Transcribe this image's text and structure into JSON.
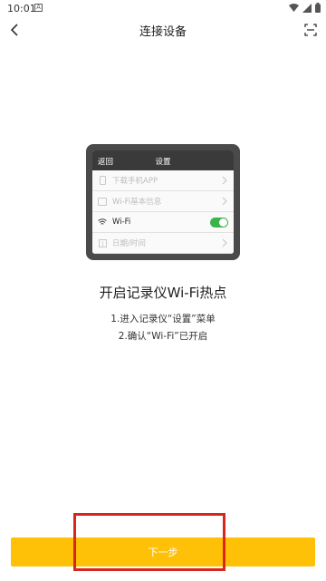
{
  "status_bar": {
    "time": "10:01",
    "notif": "A"
  },
  "header": {
    "title": "连接设备"
  },
  "device_screen": {
    "back": "返回",
    "title": "设置",
    "rows": [
      {
        "label": "下载手机APP"
      },
      {
        "label": "Wi-Fi基本信息"
      },
      {
        "label": "Wi-Fi"
      },
      {
        "label": "日期/时间"
      }
    ]
  },
  "main": {
    "heading": "开启记录仪Wi-Fi热点",
    "step1": "1.进入记录仪“设置”菜单",
    "step2": "2.确认“Wi-Fi”已开启"
  },
  "footer": {
    "next_label": "下一步"
  },
  "colors": {
    "accent": "#ffc107",
    "toggle_on": "#3cb34a",
    "highlight": "#d9261c"
  }
}
